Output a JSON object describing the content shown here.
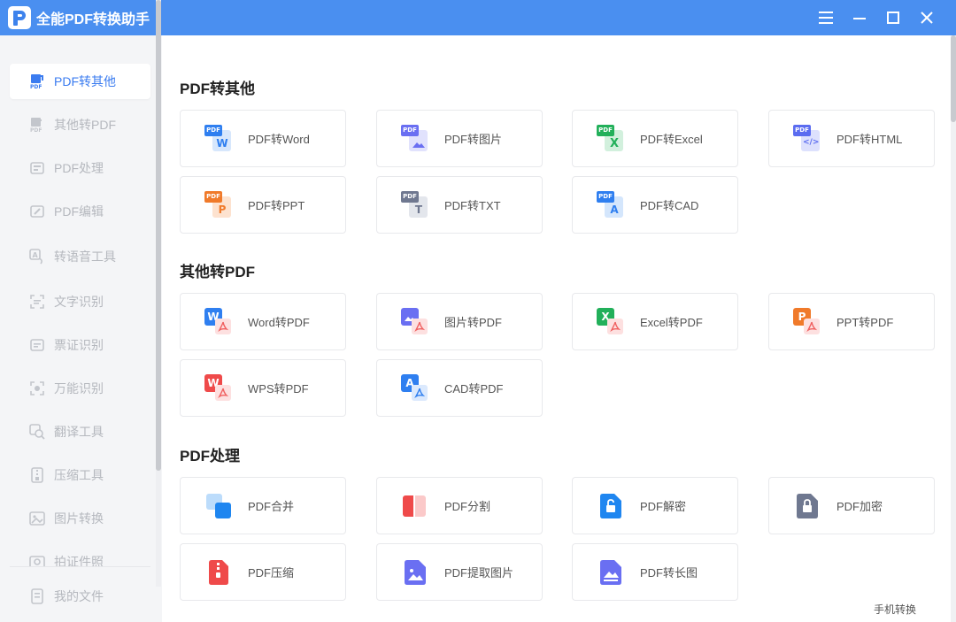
{
  "app": {
    "title": "全能PDF转换助手"
  },
  "window_controls": {
    "menu": "menu-icon",
    "minimize": "minimize-icon",
    "maximize": "maximize-icon",
    "close": "close-icon"
  },
  "sidebar": {
    "items": [
      {
        "label": "PDF转其他",
        "icon": "pdf-export-icon",
        "active": true
      },
      {
        "label": "其他转PDF",
        "icon": "pdf-import-icon",
        "active": false
      },
      {
        "label": "PDF处理",
        "icon": "pdf-process-icon",
        "active": false
      },
      {
        "label": "PDF编辑",
        "icon": "pdf-edit-icon",
        "active": false
      },
      {
        "label": "转语音工具",
        "icon": "text-to-speech-icon",
        "active": false
      },
      {
        "label": "文字识别",
        "icon": "ocr-icon",
        "active": false
      },
      {
        "label": "票证识别",
        "icon": "ticket-ocr-icon",
        "active": false
      },
      {
        "label": "万能识别",
        "icon": "universal-ocr-icon",
        "active": false
      },
      {
        "label": "翻译工具",
        "icon": "translate-icon",
        "active": false
      },
      {
        "label": "压缩工具",
        "icon": "compress-icon",
        "active": false
      },
      {
        "label": "图片转换",
        "icon": "image-convert-icon",
        "active": false
      },
      {
        "label": "拍证件照",
        "icon": "id-photo-icon",
        "active": false
      }
    ],
    "my_files": "我的文件"
  },
  "sections": [
    {
      "title": "PDF转其他",
      "cards": [
        {
          "label": "PDF转Word",
          "icon": "pdf-to-word-icon"
        },
        {
          "label": "PDF转图片",
          "icon": "pdf-to-image-icon"
        },
        {
          "label": "PDF转Excel",
          "icon": "pdf-to-excel-icon"
        },
        {
          "label": "PDF转HTML",
          "icon": "pdf-to-html-icon"
        },
        {
          "label": "PDF转PPT",
          "icon": "pdf-to-ppt-icon"
        },
        {
          "label": "PDF转TXT",
          "icon": "pdf-to-txt-icon"
        },
        {
          "label": "PDF转CAD",
          "icon": "pdf-to-cad-icon"
        }
      ]
    },
    {
      "title": "其他转PDF",
      "cards": [
        {
          "label": "Word转PDF",
          "icon": "word-to-pdf-icon"
        },
        {
          "label": "图片转PDF",
          "icon": "image-to-pdf-icon"
        },
        {
          "label": "Excel转PDF",
          "icon": "excel-to-pdf-icon"
        },
        {
          "label": "PPT转PDF",
          "icon": "ppt-to-pdf-icon"
        },
        {
          "label": "WPS转PDF",
          "icon": "wps-to-pdf-icon"
        },
        {
          "label": "CAD转PDF",
          "icon": "cad-to-pdf-icon"
        }
      ]
    },
    {
      "title": "PDF处理",
      "cards": [
        {
          "label": "PDF合并",
          "icon": "pdf-merge-icon"
        },
        {
          "label": "PDF分割",
          "icon": "pdf-split-icon"
        },
        {
          "label": "PDF解密",
          "icon": "pdf-unlock-icon"
        },
        {
          "label": "PDF加密",
          "icon": "pdf-lock-icon"
        },
        {
          "label": "PDF压缩",
          "icon": "pdf-compress-icon"
        },
        {
          "label": "PDF提取图片",
          "icon": "pdf-extract-image-icon"
        },
        {
          "label": "PDF转长图",
          "icon": "pdf-to-long-image-icon"
        }
      ]
    }
  ],
  "footer": {
    "mobile_convert": "手机转换"
  },
  "colors": {
    "titlebar": "#4a8ff0",
    "accent": "#3b7cf0",
    "word": "#2f7ff0",
    "image": "#6a6ff2",
    "excel": "#22b05a",
    "ppt": "#f07a2a",
    "wps": "#ef4a4a",
    "txt": "#6f7890",
    "pdf_red": "#f06060"
  }
}
